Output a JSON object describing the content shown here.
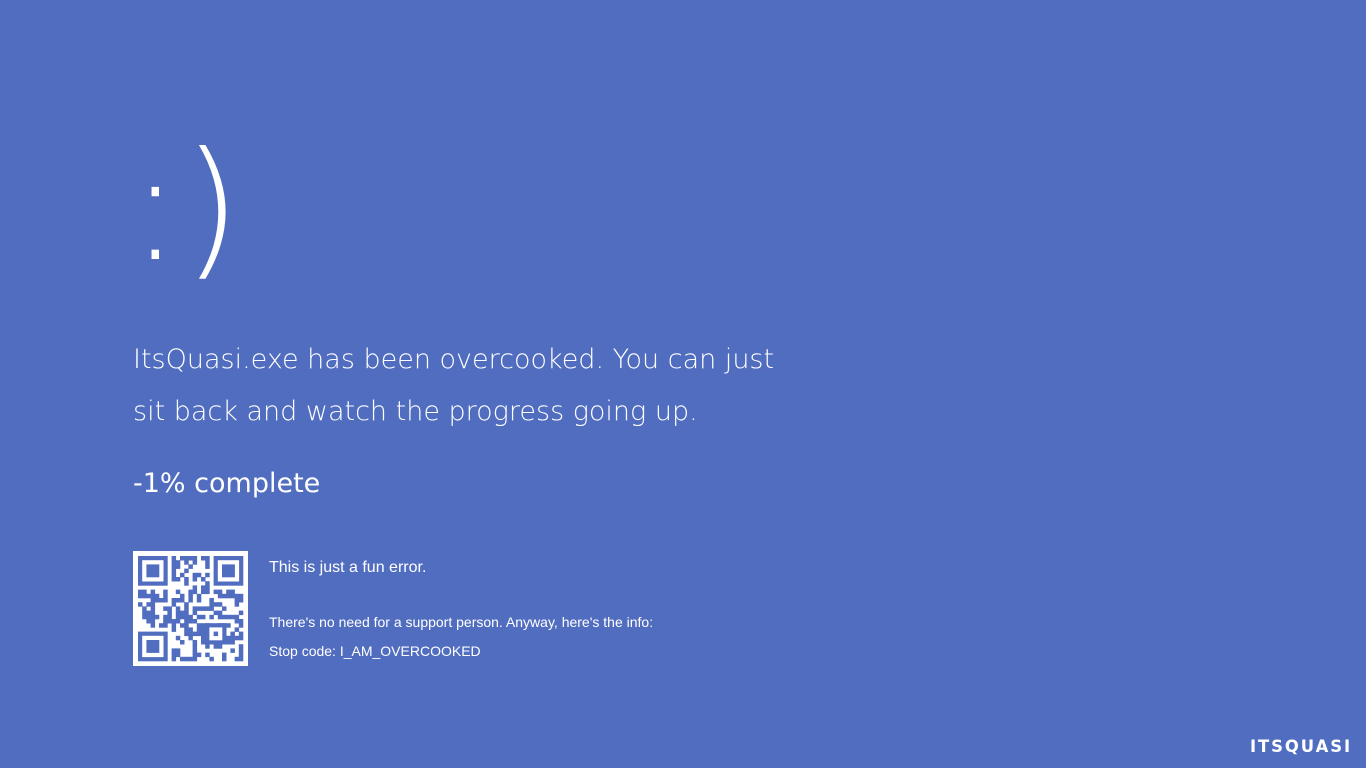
{
  "screen": {
    "background_color": "#516dc0",
    "text_color": "#ffffff"
  },
  "face": {
    "text": ":)"
  },
  "message": {
    "line1": "ItsQuasi.exe has been overcooked. You can just",
    "line2": "sit back and watch the progress going up."
  },
  "progress": {
    "text": "-1% complete",
    "percent": -1
  },
  "qr_code": {
    "icon": "qr-code-icon"
  },
  "info": {
    "fun_text": "This is just a fun error.",
    "support_text": "There's no need for a support person. Anyway, here's the info:",
    "stop_code_text": "Stop code: I_AM_OVERCOOKED"
  },
  "watermark": {
    "text": "ITSQUASI"
  }
}
